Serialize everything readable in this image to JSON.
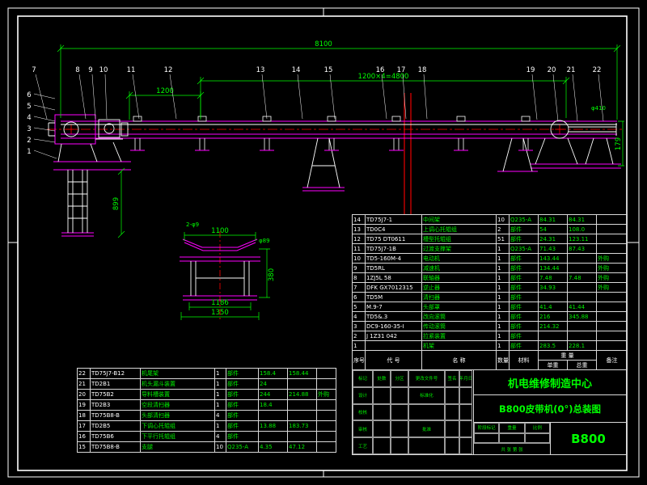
{
  "colors": {
    "background": "#000000",
    "lines": "#ffffff",
    "structure": "#ff00ff",
    "dimensions": "#00ff00",
    "centerlines": "#ff0000"
  },
  "drawing": {
    "balloons_top": [
      "7",
      "8",
      "9",
      "10",
      "11",
      "12",
      "13",
      "14",
      "15",
      "16",
      "17",
      "18",
      "19",
      "20",
      "21",
      "22"
    ],
    "balloons_left": [
      "6",
      "5",
      "4",
      "3",
      "2",
      "1"
    ],
    "dims_main": {
      "overall": "8100",
      "span": "1200×4=4800",
      "left": "1200",
      "leg": "899",
      "tail_h": "179",
      "pulley": "φ410"
    },
    "dims_cross": {
      "top": "1100",
      "note": "2-φ9",
      "w1": "1186",
      "w2": "1350",
      "h": "380",
      "roller": "φ89"
    }
  },
  "bom_left": {
    "rows": [
      [
        "22",
        "TD75J7-B12",
        "机尾架",
        "1",
        "部件",
        "158.4",
        "158.44",
        ""
      ],
      [
        "21",
        "TD2B1",
        "机头漏斗装置",
        "1",
        "部件",
        "24",
        "",
        ""
      ],
      [
        "20",
        "TD75B2",
        "导料槽装置",
        "1",
        "部件",
        "244",
        "214.88",
        "外购"
      ],
      [
        "19",
        "TD2B3",
        "空段清扫器",
        "1",
        "部件",
        "18.4",
        "",
        ""
      ],
      [
        "18",
        "TD75B8-B",
        "头部清扫器",
        "4",
        "部件",
        "",
        "",
        ""
      ],
      [
        "17",
        "TD2B5",
        "下调心托辊组",
        "1",
        "部件",
        "13.88",
        "183.73",
        ""
      ],
      [
        "16",
        "TD75B6",
        "下平行托辊组",
        "4",
        "部件",
        "",
        "",
        ""
      ],
      [
        "15",
        "TD75B8-B",
        "支腿",
        "10",
        "Q235-A",
        "4.35",
        "47.12",
        ""
      ]
    ]
  },
  "bom_right": {
    "headers": {
      "no": "序号",
      "code": "代 号",
      "name": "名 称",
      "qty": "数量",
      "mat": "材料",
      "weight": "重 量",
      "unit": "单重",
      "total": "总重",
      "rem": "备注"
    },
    "rows": [
      [
        "14",
        "TD75J7-1",
        "中间架",
        "10",
        "Q235-A",
        "84.31",
        "84.31",
        ""
      ],
      [
        "13",
        "TD0C4",
        "上调心托辊组",
        "2",
        "部件",
        "54",
        "108.0",
        ""
      ],
      [
        "12",
        "TD75 DT0611",
        "槽型托辊组",
        "51",
        "部件",
        "24.31",
        "123.11",
        ""
      ],
      [
        "11",
        "TD75J7-1B",
        "过渡支撑架",
        "1",
        "Q235-A",
        "71.43",
        "87.43",
        ""
      ],
      [
        "10",
        "TD5-160M-4",
        "电动机",
        "1",
        "部件",
        "143.44",
        "",
        "外购"
      ],
      [
        "9",
        "TD5RL",
        "减速机",
        "1",
        "部件",
        "134.44",
        "",
        "外购"
      ],
      [
        "8",
        "1ZJ5L 58",
        "联轴器",
        "1",
        "部件",
        "7.48",
        "7.48",
        "外购"
      ],
      [
        "7",
        "DFK GX7012315",
        "逆止器",
        "1",
        "部件",
        "34.93",
        "",
        "外购"
      ],
      [
        "6",
        "TD5M",
        "清扫器",
        "1",
        "部件",
        "",
        "",
        ""
      ],
      [
        "5",
        "M.9-7",
        "头部罩",
        "1",
        "部件",
        "41.4",
        "41.44",
        ""
      ],
      [
        "4",
        "TD5&.3",
        "改向滚筒",
        "1",
        "部件",
        "216",
        "345.88",
        ""
      ],
      [
        "3",
        "DC9-160-35-I",
        "传动滚筒",
        "1",
        "部件",
        "214.32",
        "",
        ""
      ],
      [
        "2",
        "J 1Z31 042",
        "拉紧装置",
        "1",
        "部件",
        "",
        "",
        ""
      ],
      [
        "1",
        "",
        "机架",
        "1",
        "部件",
        "283.5",
        "228.1",
        ""
      ]
    ]
  },
  "titleblock": {
    "company": "机电维修制造中心",
    "title": "B800皮带机(0°)总装图",
    "dwg_no": "B800",
    "left_grid": [
      [
        "标记",
        "处数",
        "分区",
        "更改文件号",
        "签名",
        "年月日"
      ],
      [
        "设计",
        "",
        "",
        "标准化",
        "",
        ""
      ],
      [
        "校核",
        "",
        "",
        "",
        "",
        ""
      ],
      [
        "审核",
        "",
        "",
        "批准",
        "",
        ""
      ],
      [
        "工艺",
        "",
        "",
        "",
        "",
        ""
      ]
    ],
    "stage_labels": [
      "阶段标记",
      "重量",
      "比例"
    ],
    "sheet": "共 张 第 张"
  }
}
